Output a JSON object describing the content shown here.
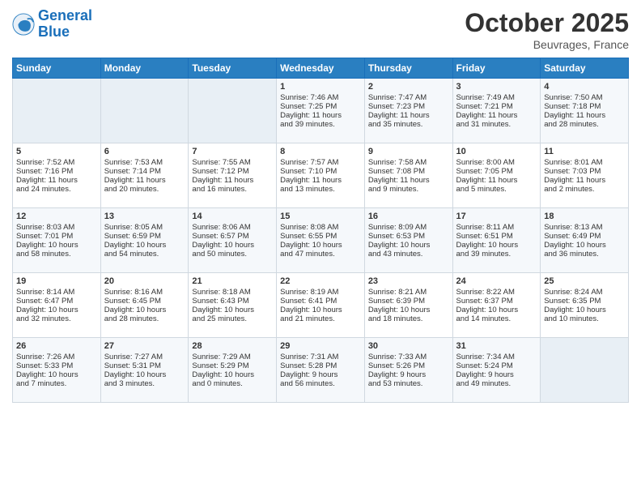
{
  "header": {
    "logo_line1": "General",
    "logo_line2": "Blue",
    "month_title": "October 2025",
    "location": "Beuvrages, France"
  },
  "days_of_week": [
    "Sunday",
    "Monday",
    "Tuesday",
    "Wednesday",
    "Thursday",
    "Friday",
    "Saturday"
  ],
  "weeks": [
    [
      {
        "day": "",
        "content": ""
      },
      {
        "day": "",
        "content": ""
      },
      {
        "day": "",
        "content": ""
      },
      {
        "day": "1",
        "content": "Sunrise: 7:46 AM\nSunset: 7:25 PM\nDaylight: 11 hours\nand 39 minutes."
      },
      {
        "day": "2",
        "content": "Sunrise: 7:47 AM\nSunset: 7:23 PM\nDaylight: 11 hours\nand 35 minutes."
      },
      {
        "day": "3",
        "content": "Sunrise: 7:49 AM\nSunset: 7:21 PM\nDaylight: 11 hours\nand 31 minutes."
      },
      {
        "day": "4",
        "content": "Sunrise: 7:50 AM\nSunset: 7:18 PM\nDaylight: 11 hours\nand 28 minutes."
      }
    ],
    [
      {
        "day": "5",
        "content": "Sunrise: 7:52 AM\nSunset: 7:16 PM\nDaylight: 11 hours\nand 24 minutes."
      },
      {
        "day": "6",
        "content": "Sunrise: 7:53 AM\nSunset: 7:14 PM\nDaylight: 11 hours\nand 20 minutes."
      },
      {
        "day": "7",
        "content": "Sunrise: 7:55 AM\nSunset: 7:12 PM\nDaylight: 11 hours\nand 16 minutes."
      },
      {
        "day": "8",
        "content": "Sunrise: 7:57 AM\nSunset: 7:10 PM\nDaylight: 11 hours\nand 13 minutes."
      },
      {
        "day": "9",
        "content": "Sunrise: 7:58 AM\nSunset: 7:08 PM\nDaylight: 11 hours\nand 9 minutes."
      },
      {
        "day": "10",
        "content": "Sunrise: 8:00 AM\nSunset: 7:05 PM\nDaylight: 11 hours\nand 5 minutes."
      },
      {
        "day": "11",
        "content": "Sunrise: 8:01 AM\nSunset: 7:03 PM\nDaylight: 11 hours\nand 2 minutes."
      }
    ],
    [
      {
        "day": "12",
        "content": "Sunrise: 8:03 AM\nSunset: 7:01 PM\nDaylight: 10 hours\nand 58 minutes."
      },
      {
        "day": "13",
        "content": "Sunrise: 8:05 AM\nSunset: 6:59 PM\nDaylight: 10 hours\nand 54 minutes."
      },
      {
        "day": "14",
        "content": "Sunrise: 8:06 AM\nSunset: 6:57 PM\nDaylight: 10 hours\nand 50 minutes."
      },
      {
        "day": "15",
        "content": "Sunrise: 8:08 AM\nSunset: 6:55 PM\nDaylight: 10 hours\nand 47 minutes."
      },
      {
        "day": "16",
        "content": "Sunrise: 8:09 AM\nSunset: 6:53 PM\nDaylight: 10 hours\nand 43 minutes."
      },
      {
        "day": "17",
        "content": "Sunrise: 8:11 AM\nSunset: 6:51 PM\nDaylight: 10 hours\nand 39 minutes."
      },
      {
        "day": "18",
        "content": "Sunrise: 8:13 AM\nSunset: 6:49 PM\nDaylight: 10 hours\nand 36 minutes."
      }
    ],
    [
      {
        "day": "19",
        "content": "Sunrise: 8:14 AM\nSunset: 6:47 PM\nDaylight: 10 hours\nand 32 minutes."
      },
      {
        "day": "20",
        "content": "Sunrise: 8:16 AM\nSunset: 6:45 PM\nDaylight: 10 hours\nand 28 minutes."
      },
      {
        "day": "21",
        "content": "Sunrise: 8:18 AM\nSunset: 6:43 PM\nDaylight: 10 hours\nand 25 minutes."
      },
      {
        "day": "22",
        "content": "Sunrise: 8:19 AM\nSunset: 6:41 PM\nDaylight: 10 hours\nand 21 minutes."
      },
      {
        "day": "23",
        "content": "Sunrise: 8:21 AM\nSunset: 6:39 PM\nDaylight: 10 hours\nand 18 minutes."
      },
      {
        "day": "24",
        "content": "Sunrise: 8:22 AM\nSunset: 6:37 PM\nDaylight: 10 hours\nand 14 minutes."
      },
      {
        "day": "25",
        "content": "Sunrise: 8:24 AM\nSunset: 6:35 PM\nDaylight: 10 hours\nand 10 minutes."
      }
    ],
    [
      {
        "day": "26",
        "content": "Sunrise: 7:26 AM\nSunset: 5:33 PM\nDaylight: 10 hours\nand 7 minutes."
      },
      {
        "day": "27",
        "content": "Sunrise: 7:27 AM\nSunset: 5:31 PM\nDaylight: 10 hours\nand 3 minutes."
      },
      {
        "day": "28",
        "content": "Sunrise: 7:29 AM\nSunset: 5:29 PM\nDaylight: 10 hours\nand 0 minutes."
      },
      {
        "day": "29",
        "content": "Sunrise: 7:31 AM\nSunset: 5:28 PM\nDaylight: 9 hours\nand 56 minutes."
      },
      {
        "day": "30",
        "content": "Sunrise: 7:33 AM\nSunset: 5:26 PM\nDaylight: 9 hours\nand 53 minutes."
      },
      {
        "day": "31",
        "content": "Sunrise: 7:34 AM\nSunset: 5:24 PM\nDaylight: 9 hours\nand 49 minutes."
      },
      {
        "day": "",
        "content": ""
      }
    ]
  ]
}
